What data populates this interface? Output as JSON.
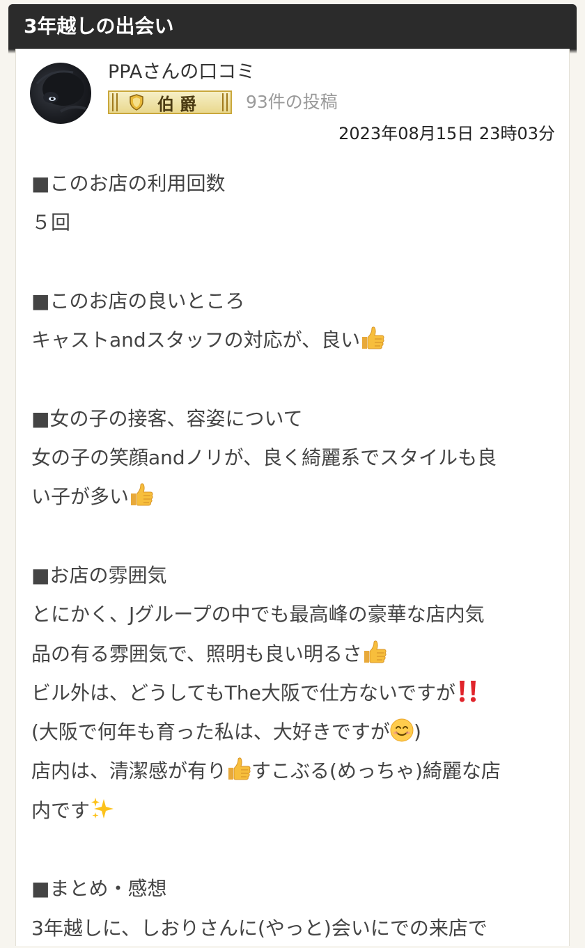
{
  "header": {
    "title": "3年越しの出会い"
  },
  "author": {
    "name": "PPAさんの口コミ",
    "rank": "伯爵",
    "post_count": "93件の投稿",
    "date": "2023年08月15日 23時03分"
  },
  "review": {
    "visit_heading": "■このお店の利用回数",
    "visit_count": "５回",
    "good_heading": "■このお店の良いところ",
    "good_text": "キャストandスタッフの対応が、良い",
    "girls_heading": "■女の子の接客、容姿について",
    "girls_text_1": "女の子の笑顔andノリが、良く綺麗系でスタイルも良",
    "girls_text_2": "い子が多い",
    "atmosphere_heading": "■お店の雰囲気",
    "atmosphere_1": "とにかく、Jグループの中でも最高峰の豪華な店内気",
    "atmosphere_2": "品の有る雰囲気で、照明も良い明るさ",
    "atmosphere_3": "ビル外は、どうしてもThe大阪で仕方ないですが",
    "atmosphere_4a": "(大阪で何年も育った私は、大好きですが",
    "atmosphere_4b": ")",
    "atmosphere_5a": "店内は、清潔感が有り",
    "atmosphere_5b": "すこぶる(めっちゃ)綺麗な店",
    "atmosphere_6": "内です",
    "summary_heading": "■まとめ・感想",
    "summary_1": "3年越しに、しおりさんに(やっと)会いにでの来店で"
  },
  "icons": {
    "thumbs_up": "thumbs-up-emoji",
    "double_exclamation": "double-exclamation-emoji",
    "smile": "smiling-face-emoji",
    "sparkles": "sparkles-emoji",
    "rank_shield": "shield-icon"
  },
  "colors": {
    "header_bg": "#2b2b2b",
    "page_bg": "#f7f5ef",
    "rank_gold": "#c9a73b",
    "muted_text": "#9a9a9a"
  }
}
